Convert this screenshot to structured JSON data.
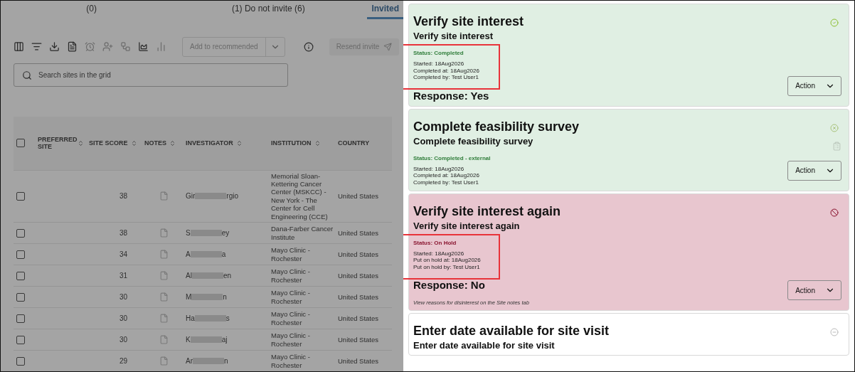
{
  "tabs": [
    {
      "label": "(0)",
      "selected": false
    },
    {
      "label": "(1)  Do not invite (6)",
      "selected": false
    },
    {
      "label": "Invited",
      "selected": true
    }
  ],
  "toolbar": {
    "recommend_button": "Add to recommended",
    "resend_button": "Resend invite"
  },
  "search": {
    "placeholder": "Search sites in the grid"
  },
  "table": {
    "select_all_checked": false,
    "columns": [
      "PREFERRED SITE",
      "SITE SCORE",
      "NOTES",
      "INVESTIGATOR",
      "INSTITUTION",
      "COUNTRY"
    ],
    "rows": [
      {
        "checked": false,
        "score": "38",
        "investigator_start": "Gir",
        "investigator_end": "rgio",
        "institution": "Memorial Sloan-Kettering Cancer Center (MSKCC) - New York - The Center for Cell Engineering (CCE)",
        "country": "United States"
      },
      {
        "checked": false,
        "score": "38",
        "investigator_start": "S",
        "investigator_end": "ey",
        "institution": "Dana-Farber Cancer Institute",
        "country": "United States"
      },
      {
        "checked": false,
        "score": "34",
        "investigator_start": "A",
        "investigator_end": "a",
        "institution": "Mayo Clinic - Rochester",
        "country": "United States"
      },
      {
        "checked": false,
        "score": "31",
        "investigator_start": "Al",
        "investigator_end": "en",
        "institution": "Mayo Clinic - Rochester",
        "country": "United States"
      },
      {
        "checked": false,
        "score": "30",
        "investigator_start": "M",
        "investigator_end": "n",
        "institution": "Mayo Clinic - Rochester",
        "country": "United States"
      },
      {
        "checked": false,
        "score": "30",
        "investigator_start": "Ha",
        "investigator_end": "s",
        "institution": "Mayo Clinic - Rochester",
        "country": "United States"
      },
      {
        "checked": false,
        "score": "30",
        "investigator_start": "K",
        "investigator_end": "aj",
        "institution": "Mayo Clinic - Rochester",
        "country": "United States"
      },
      {
        "checked": false,
        "score": "29",
        "investigator_start": "Ar",
        "investigator_end": "n",
        "institution": "Mayo Clinic - Rochester",
        "country": "United States"
      }
    ]
  },
  "tasks": [
    {
      "kind": "completed",
      "title": "Verify site interest",
      "subtitle": "Verify site interest",
      "status": "Status: Completed",
      "details": [
        "Started: 18Aug2026",
        "Completed at: 18Aug2026",
        "Completed by: Test User1"
      ],
      "response": "Response: Yes",
      "highlighted": true,
      "action": "Action"
    },
    {
      "kind": "external",
      "title": "Complete feasibility survey",
      "subtitle": "Complete feasibility survey",
      "status": "Status: Completed - external",
      "details": [
        "Started: 18Aug2026",
        "Completed at: 18Aug2026",
        "Completed by: Test User1"
      ],
      "highlighted": false,
      "action": "Action"
    },
    {
      "kind": "on_hold",
      "title": "Verify site interest again",
      "subtitle": "Verify site interest again",
      "status": "Status: On Hold",
      "details": [
        "Started: 18Aug2026",
        "Put on hold at: 18Aug2026",
        "Put on hold by: Test User1"
      ],
      "response": "Response: No",
      "note": "View reasons for disinterest on the Site notes tab",
      "highlighted": true,
      "action": "Action"
    },
    {
      "kind": "not_started",
      "title": "Enter date available for site visit",
      "subtitle": "Enter date available for site visit",
      "highlighted": false
    }
  ]
}
